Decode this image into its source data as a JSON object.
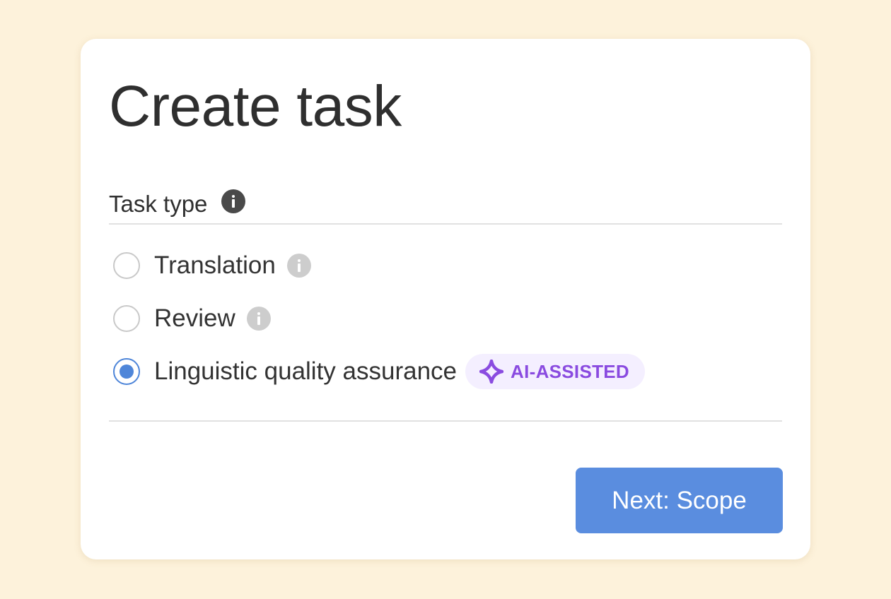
{
  "dialog": {
    "title": "Create task"
  },
  "task_type": {
    "label": "Task type",
    "info_icon": "info-icon",
    "options": [
      {
        "label": "Translation",
        "selected": false,
        "info_icon": "info-icon"
      },
      {
        "label": "Review",
        "selected": false,
        "info_icon": "info-icon"
      },
      {
        "label": "Linguistic quality assurance",
        "selected": true,
        "badge": "AI-ASSISTED",
        "badge_icon": "sparkle-icon"
      }
    ]
  },
  "actions": {
    "next_label": "Next: Scope"
  },
  "colors": {
    "background": "#fdf2db",
    "card": "#ffffff",
    "accent": "#5a8ddf",
    "badge_text": "#8a4be0",
    "badge_bg": "#f4efff"
  }
}
